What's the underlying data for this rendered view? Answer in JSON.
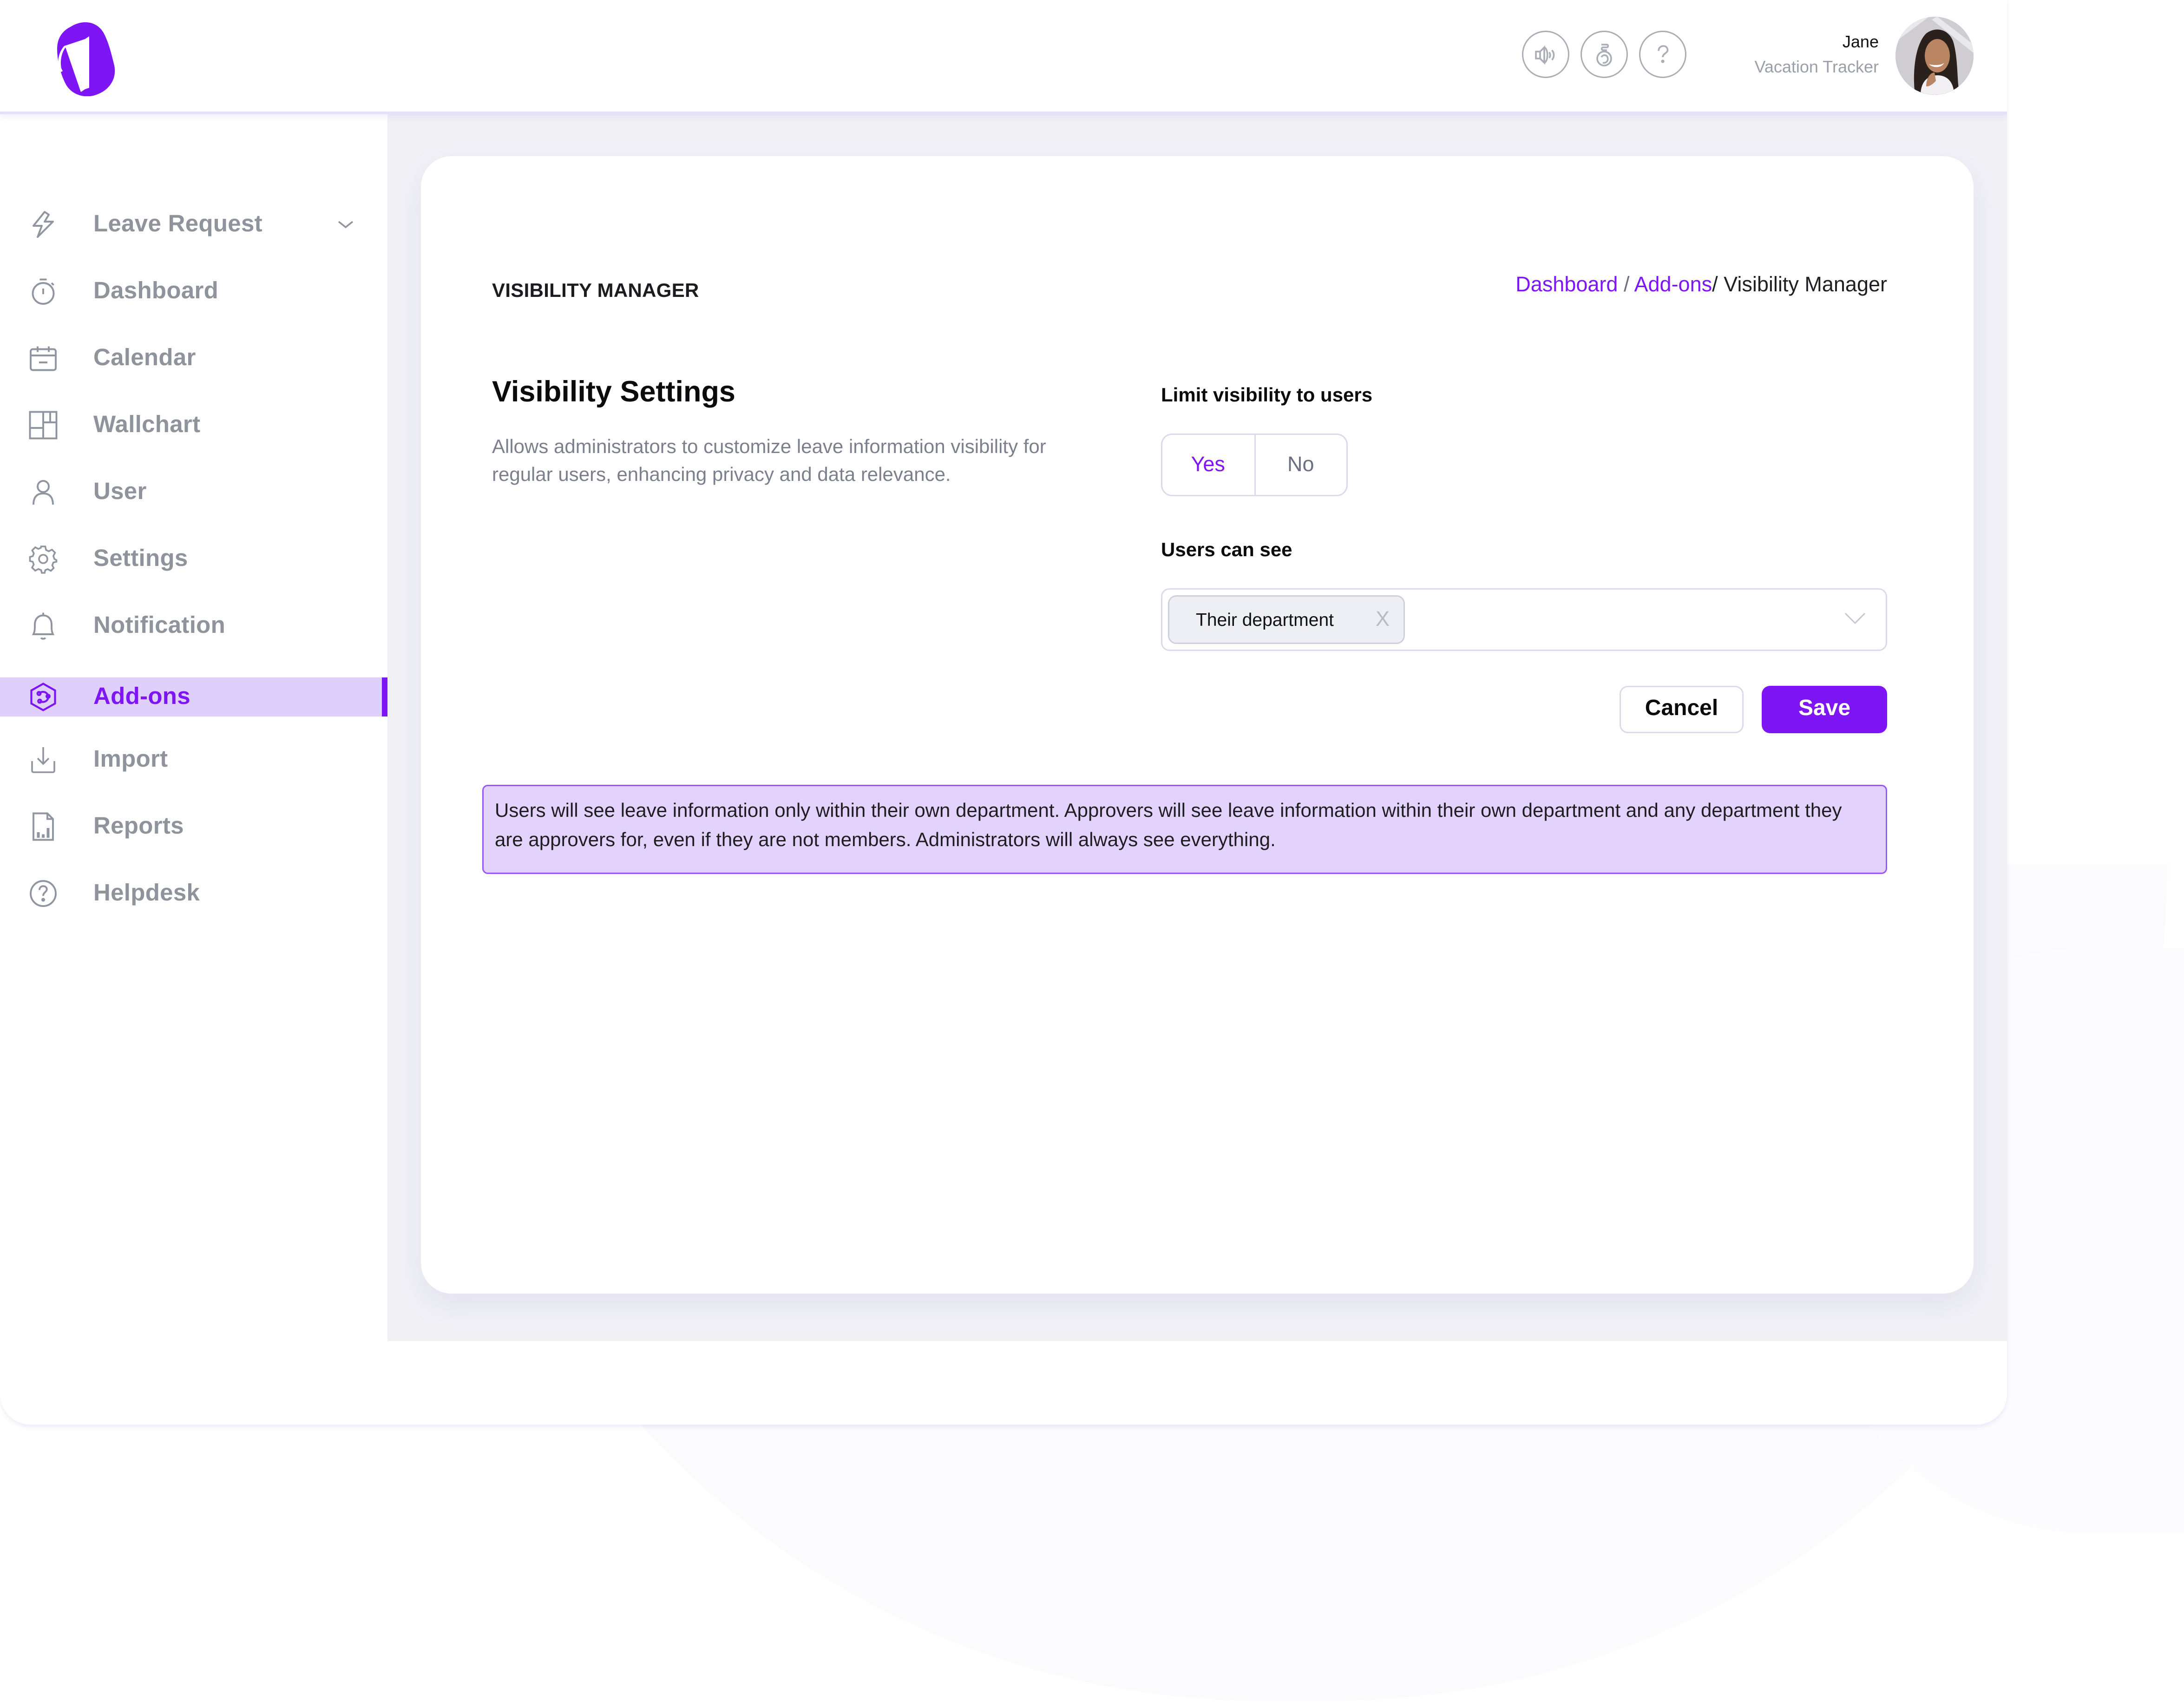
{
  "app": {
    "name": "Vacation Tracker",
    "brand_color": "#7d15f5",
    "logo_letter": "V"
  },
  "header": {
    "icons": [
      {
        "name": "announcement-icon",
        "label": "Announcements"
      },
      {
        "name": "whats-new-icon",
        "label": "What's new"
      },
      {
        "name": "help-icon",
        "label": "Help"
      }
    ],
    "user": {
      "name": "Jane",
      "subtitle": "Vacation Tracker"
    }
  },
  "sidebar": {
    "items": [
      {
        "label": "Leave Request",
        "icon": "lightning-icon",
        "has_chevron": true,
        "active": false
      },
      {
        "label": "Dashboard",
        "icon": "stopwatch-icon",
        "active": false
      },
      {
        "label": "Calendar",
        "icon": "calendar-icon",
        "active": false
      },
      {
        "label": "Wallchart",
        "icon": "wallchart-grid-icon",
        "active": false
      },
      {
        "label": "User",
        "icon": "user-icon",
        "active": false
      },
      {
        "label": "Settings",
        "icon": "gear-icon",
        "active": false
      },
      {
        "label": "Notification",
        "icon": "bell-icon",
        "active": false
      },
      {
        "label": "Add-ons",
        "icon": "addons-hexagon-icon",
        "active": true
      },
      {
        "label": "Import",
        "icon": "import-icon",
        "active": false
      },
      {
        "label": "Reports",
        "icon": "report-document-icon",
        "active": false
      },
      {
        "label": "Helpdesk",
        "icon": "help-circle-icon",
        "active": false
      }
    ]
  },
  "page": {
    "title": "VISIBILITY MANAGER",
    "breadcrumb": [
      {
        "label": "Dashboard",
        "link": true
      },
      {
        "label": "Add-ons",
        "link": true
      },
      {
        "label": "Visibility Manager",
        "link": false
      }
    ],
    "breadcrumb_sep": "/",
    "section": {
      "title": "Visibility Settings",
      "description": "Allows administrators to customize leave information visibility for regular users, enhancing privacy and data relevance."
    },
    "limit_visibility": {
      "label": "Limit visibility to users",
      "options": [
        "Yes",
        "No"
      ],
      "selected": "Yes"
    },
    "users_can_see": {
      "label": "Users can see",
      "selected_values": [
        "Their department"
      ],
      "remove_label": "X"
    },
    "buttons": {
      "cancel": "Cancel",
      "save": "Save"
    },
    "notice": "Users will see leave information only within their own department. Approvers will see leave information within their own department and any department they are approvers for, even if they are not members. Administrators will always see everything."
  }
}
